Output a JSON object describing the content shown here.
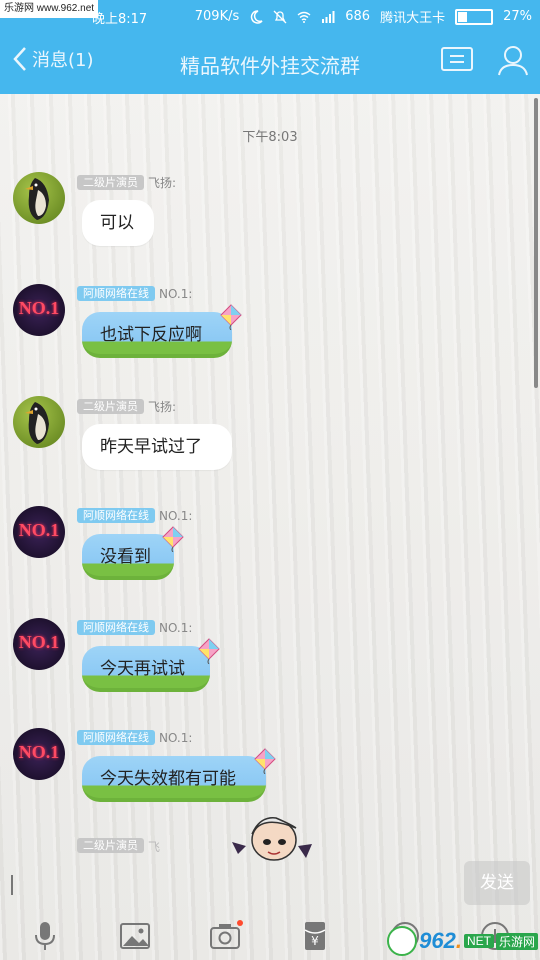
{
  "watermark": {
    "top": "乐游网 www.962.net",
    "net": "NET",
    "site_cn": "乐游网"
  },
  "status_bar": {
    "time": "晚上8:17",
    "speed": "709K/s",
    "carrier": "腾讯大王卡",
    "battery": "27%",
    "battery_level": 0.27,
    "signal": "686"
  },
  "header": {
    "back_label": "消息(1)",
    "title": "精品软件外挂交流群",
    "card_icon": "profile-card-icon",
    "member_icon": "group-members-icon"
  },
  "timestamp": "下午8:03",
  "messages": [
    {
      "sender_badge": "二级片演员",
      "sender": "飞扬:",
      "text": "可以",
      "avatar": "penguin",
      "style": "white"
    },
    {
      "sender_badge": "阿顺网络在线",
      "sender": "NO.1:",
      "text": "也试下反应啊",
      "avatar": "no1",
      "style": "sky"
    },
    {
      "sender_badge": "二级片演员",
      "sender": "飞扬:",
      "text": "昨天早试过了",
      "avatar": "penguin",
      "style": "white"
    },
    {
      "sender_badge": "阿顺网络在线",
      "sender": "NO.1:",
      "text": "没看到",
      "avatar": "no1",
      "style": "sky"
    },
    {
      "sender_badge": "阿顺网络在线",
      "sender": "NO.1:",
      "text": "今天再试试",
      "avatar": "no1",
      "style": "sky"
    },
    {
      "sender_badge": "阿顺网络在线",
      "sender": "NO.1:",
      "text": "今天失效都有可能",
      "avatar": "no1",
      "style": "sky"
    }
  ],
  "partial_message": {
    "sender_badge": "二级片演员",
    "sender": "飞"
  },
  "avatar_text": "NO.1",
  "input": {
    "send_label": "发送"
  },
  "toolbar": [
    "microphone-icon",
    "image-icon",
    "camera-icon",
    "red-packet-icon",
    "emoji-icon",
    "plus-icon"
  ],
  "colors": {
    "accent": "#45b7ee",
    "bubble_sky": "#8cc9f4",
    "bubble_grass": "#79c043"
  }
}
